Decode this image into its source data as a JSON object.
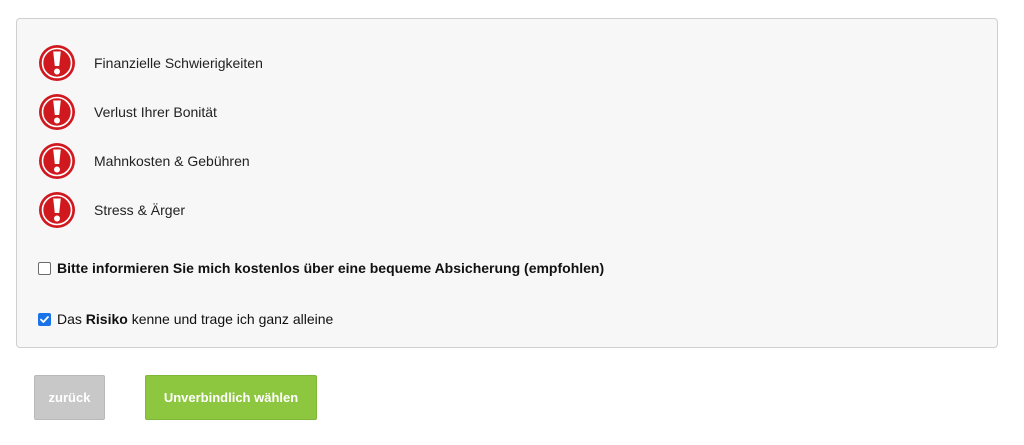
{
  "risks": {
    "icon": "exclamation-warning-icon",
    "icon_color": "#d0191f",
    "items": [
      {
        "label": "Finanzielle Schwierigkeiten"
      },
      {
        "label": "Verlust Ihrer Bonität"
      },
      {
        "label": "Mahnkosten & Gebühren"
      },
      {
        "label": "Stress & Ärger"
      }
    ]
  },
  "options": {
    "inform": {
      "checked": false,
      "label": "Bitte informieren Sie mich kostenlos über eine bequeme Absicherung (empfohlen)"
    },
    "risk": {
      "checked": true,
      "label_pre": "Das ",
      "label_bold": "Risiko",
      "label_post": " kenne und trage ich ganz alleine"
    }
  },
  "buttons": {
    "back_label": "zurück",
    "back_color": "#c8c8c8",
    "choose_label": "Unverbindlich wählen",
    "choose_color": "#8dc63f"
  }
}
